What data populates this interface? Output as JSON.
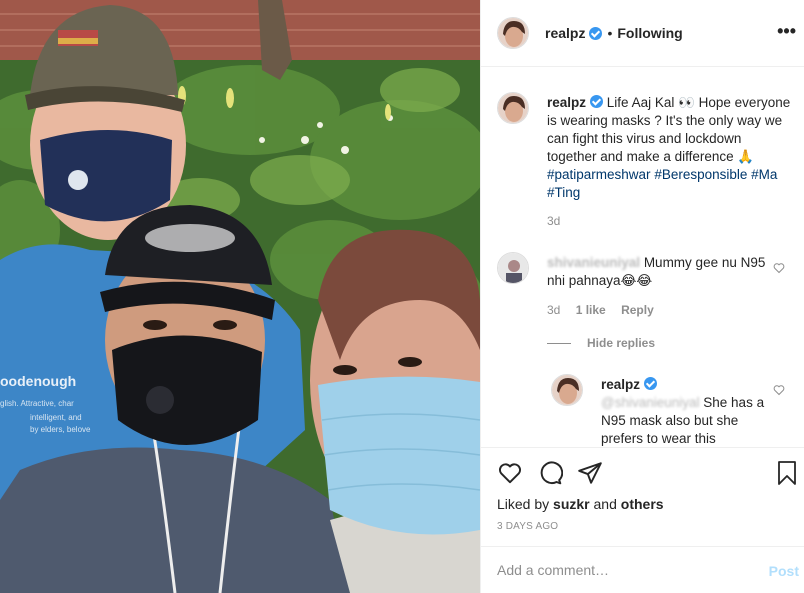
{
  "post": {
    "username": "realpz",
    "follow_label": "Following",
    "separator": "•",
    "more_glyph": "•••"
  },
  "caption": {
    "username": "realpz",
    "text": "Life Aaj Kal 👀 Hope everyone is wearing masks ? It's the only way we can fight this virus and lockdown together and make a difference 🙏",
    "hashtags": [
      "#patiparmeshwar",
      "#Beresponsible",
      "#Ma",
      "#Ting"
    ],
    "time": "3d"
  },
  "comment1": {
    "username": "shivanieuniyal",
    "text": "Mummy gee nu N95 nhi pahnaya😂😂",
    "time": "3d",
    "likes": "1 like",
    "reply": "Reply",
    "hide_replies": "Hide replies"
  },
  "reply1": {
    "username": "realpz",
    "mention": "@shivanieuniyal",
    "text": "She has a N95 mask also but she prefers to wear this"
  },
  "footer": {
    "liked_prefix": "Liked by",
    "liked_user": "suzkr",
    "liked_and": "and",
    "liked_others": "others",
    "date": "3 DAYS AGO",
    "comment_placeholder": "Add a comment…",
    "post_label": "Post"
  },
  "icons": {
    "like": "heart-icon",
    "comment": "comment-icon",
    "share": "share-icon",
    "save": "bookmark-icon",
    "verified": "verified-badge-icon"
  },
  "colors": {
    "verified": "#3897f0",
    "hashtag": "#00376b",
    "muted": "#8e8e8e",
    "post_disabled": "#b2dffc"
  }
}
